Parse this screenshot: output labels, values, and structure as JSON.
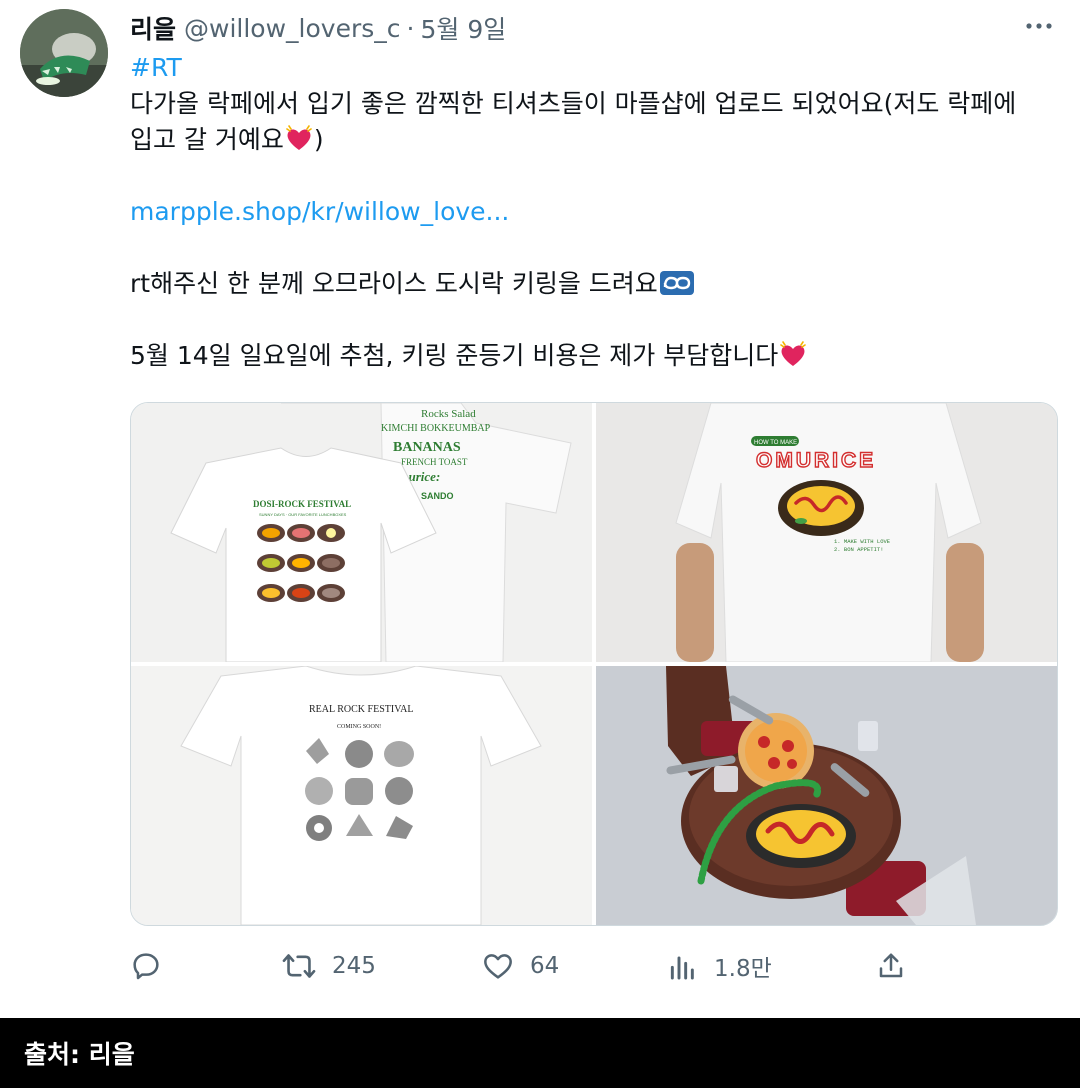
{
  "tweet": {
    "author": {
      "display_name": "리을",
      "handle": "@willow_lovers_c",
      "separator": "·",
      "date": "5월 9일"
    },
    "text": {
      "hashtag": "#RT",
      "line1": "다가올 락페에서 입기 좋은 깜찍한 티셔츠들이 마플샵에 업로드 되었어요(저도 락페에",
      "line2_a": "입고 갈 거예요",
      "line2_b": ")",
      "link": "marpple.shop/kr/willow_love...",
      "line3": "rt해주신 한 분께 오므라이스 도시락 키링을 드려요",
      "line4": "5월 14일 일요일에 추첨, 키링 준등기 비용은 제가 부담합니다"
    },
    "media": {
      "image1": {
        "front_title": "DOSI-ROCK FESTIVAL",
        "front_sub": "SUNNY DAYS · OUR FAVORITE LUNCHBOXES",
        "back_lines": [
          "Rocks Salad",
          "KIMCHI BOKKEUMBAP",
          "BANANAS",
          "FRENCH TOAST",
          "Omurice:",
          "SANDO"
        ]
      },
      "image2": {
        "small_label": "HOW TO MAKE",
        "title": "OMURICE",
        "steps": [
          "1. MAKE WITH LOVE",
          "2. BON APPETIT!"
        ]
      },
      "image3": {
        "title": "REAL ROCK FESTIVAL",
        "sub": "COMING SOON!"
      }
    },
    "actions": {
      "reply_count": "",
      "retweet_count": "245",
      "like_count": "64",
      "view_count": "1.8만"
    }
  },
  "source": {
    "label": "출처: 리을"
  },
  "colors": {
    "link": "#1d9bf0",
    "secondary_text": "#536471",
    "heart": "#e0245e",
    "source_bg": "#000000"
  },
  "icons": [
    "more-icon",
    "heart-emoji-icon",
    "loop-emoji-icon",
    "reply-icon",
    "retweet-icon",
    "like-icon",
    "views-icon",
    "share-icon"
  ]
}
